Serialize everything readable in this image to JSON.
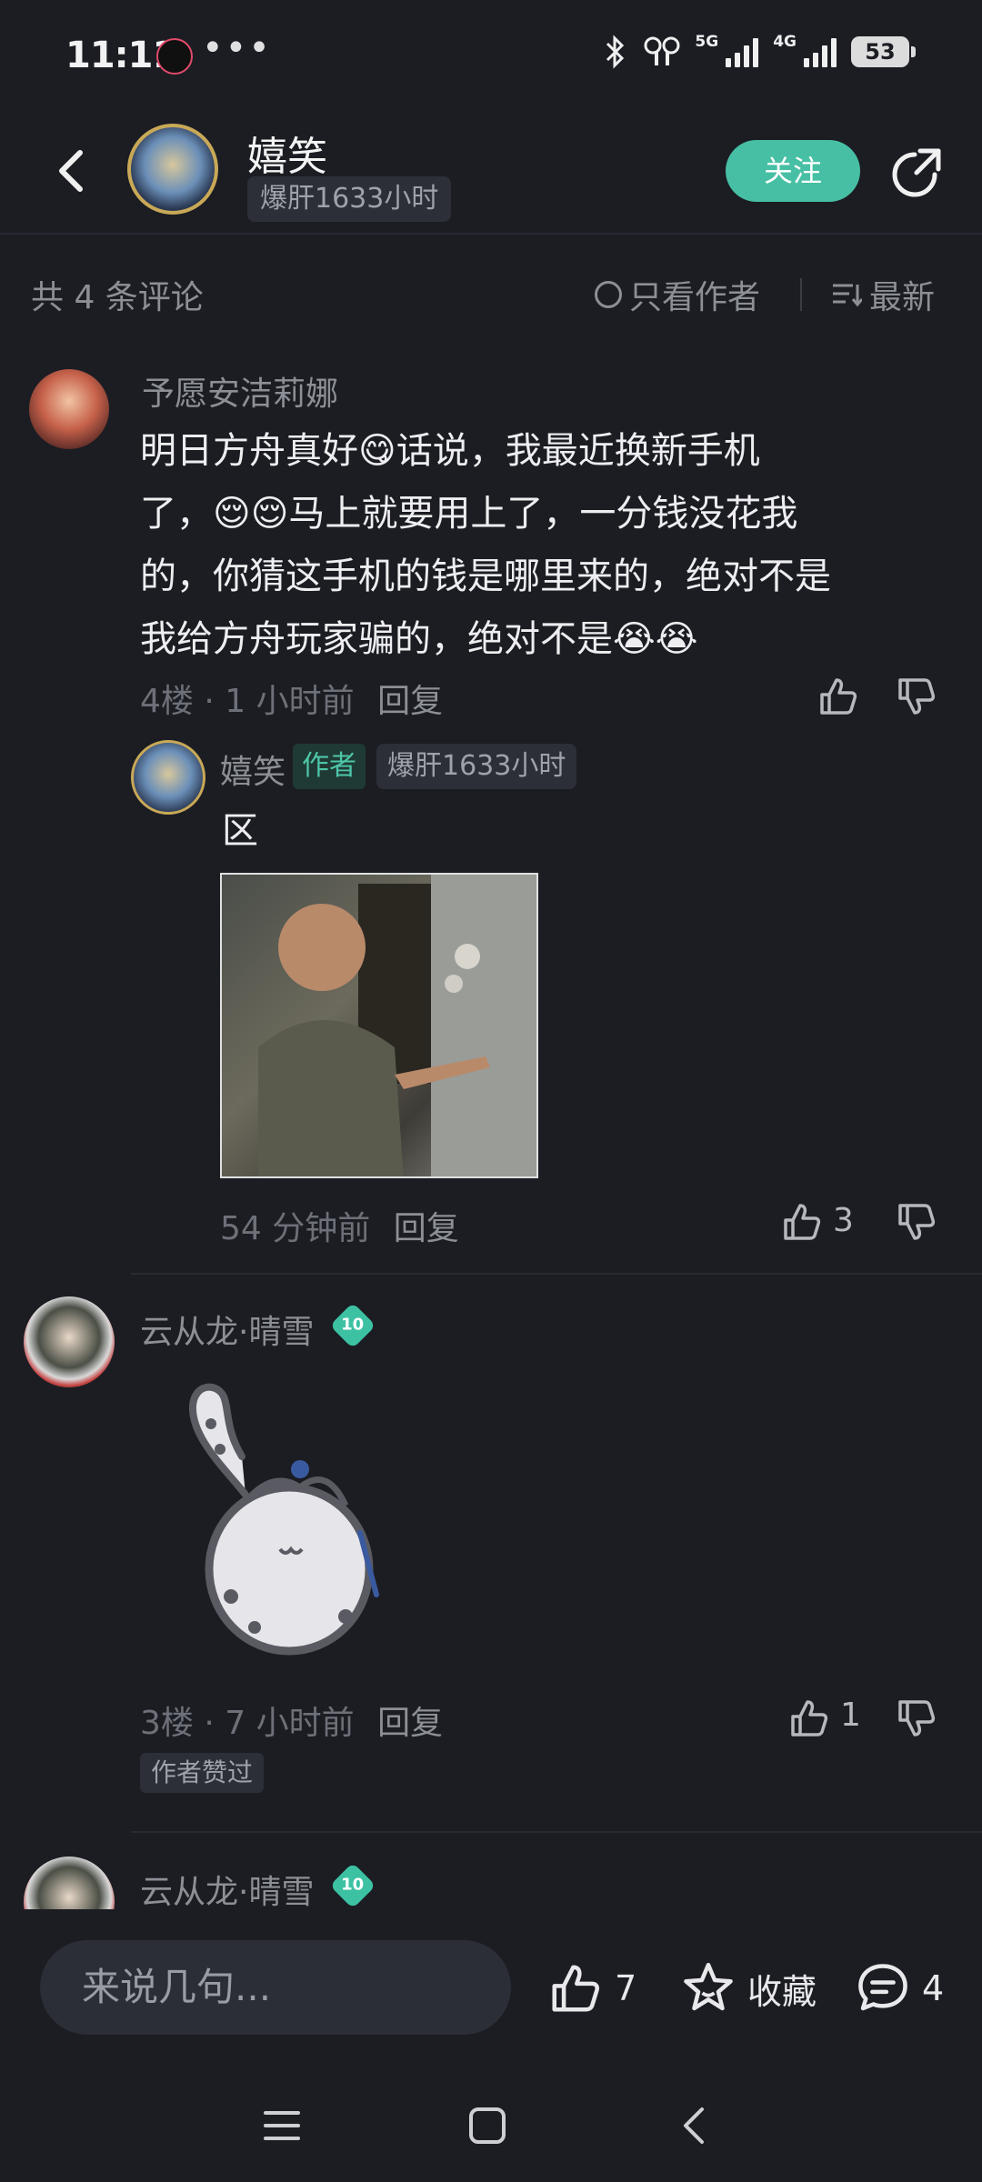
{
  "status_bar": {
    "time": "11:11",
    "more": "•••",
    "net_5g": "5G",
    "net_4g": "4G",
    "battery": "53"
  },
  "header": {
    "user_name": "嬉笑",
    "badge": "爆肝1633小时",
    "follow_label": "关注"
  },
  "comment_bar": {
    "count": "共 4 条评论",
    "author_only": "只看作者",
    "sort": "最新"
  },
  "comments": [
    {
      "user": "予愿安洁莉娜",
      "lines": [
        "明日方舟真好😋话说，我最近换新手机",
        "了，😌😌马上就要用上了，一分钱没花我",
        "的，你猜这手机的钱是哪里来的，绝对不是",
        "我给方舟玩家骗的，绝对不是😭😭"
      ],
      "floor": "4楼",
      "time": "1 小时前",
      "reply": "回复",
      "sub_reply": {
        "user": "嬉笑",
        "author_tag": "作者",
        "badge": "爆肝1633小时",
        "text": "区",
        "time": "54 分钟前",
        "reply": "回复",
        "likes": "3"
      }
    },
    {
      "user": "云从龙·晴雪",
      "level": "10",
      "floor": "3楼",
      "time": "7 小时前",
      "reply": "回复",
      "likes": "1",
      "liked_by_author": "作者赞过"
    },
    {
      "user": "云从龙·晴雪",
      "level": "10"
    }
  ],
  "bottom_bar": {
    "input_placeholder": "来说几句...",
    "likes": "7",
    "favorite": "收藏",
    "comments": "4"
  }
}
